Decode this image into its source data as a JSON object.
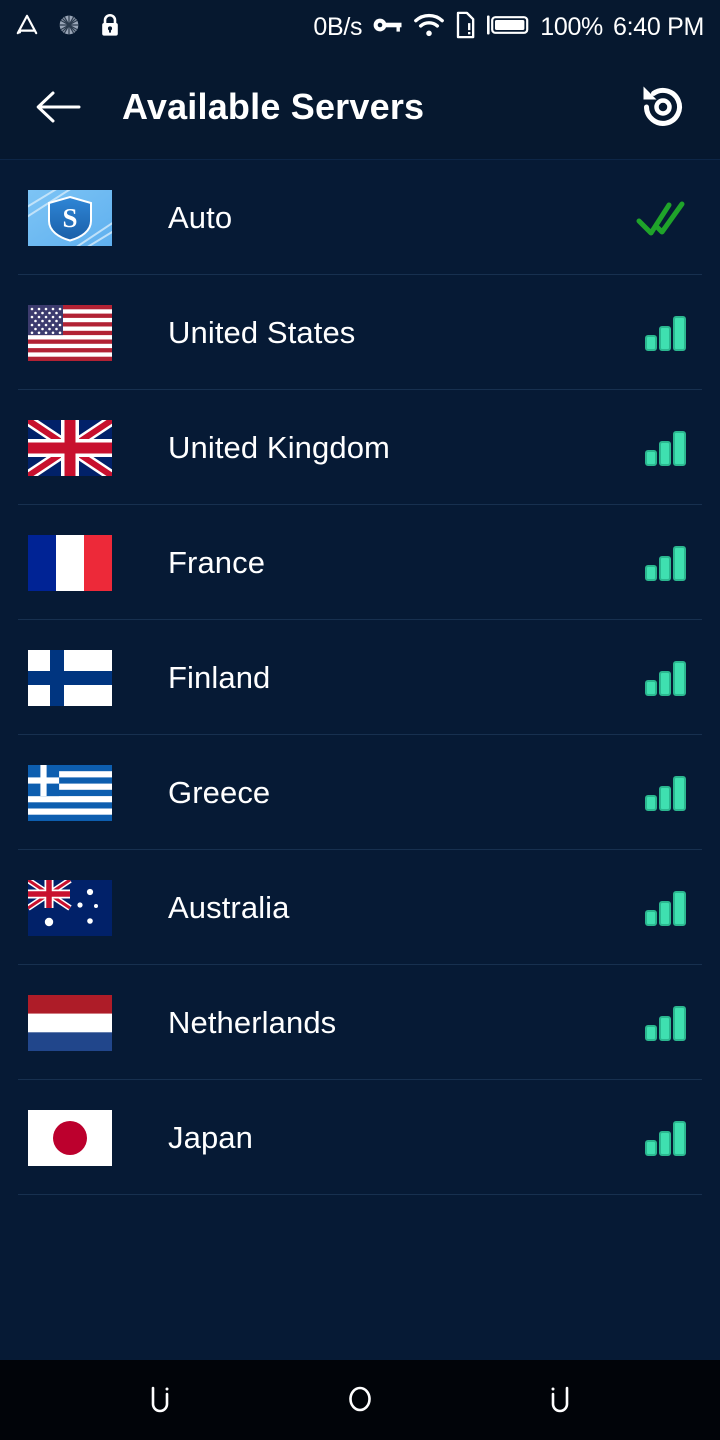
{
  "status_bar": {
    "left_icons": [
      {
        "name": "adb-triangle-icon",
        "glyph": "triangle"
      },
      {
        "name": "sync-circle-icon",
        "glyph": "dotted-circle"
      },
      {
        "name": "screen-lock-icon",
        "glyph": "lock"
      }
    ],
    "network_speed": "0B/s",
    "right_icons": [
      {
        "name": "vpn-key-icon",
        "glyph": "key"
      },
      {
        "name": "wifi-icon",
        "glyph": "wifi"
      },
      {
        "name": "sim-card-alert-icon",
        "glyph": "sim-alert"
      },
      {
        "name": "battery-full-icon",
        "glyph": "battery"
      }
    ],
    "battery_percent": "100%",
    "clock": "6:40 PM"
  },
  "header": {
    "back_label": "back-arrow",
    "title": "Available Servers",
    "refresh_label": "refresh-history"
  },
  "colors": {
    "screen_background": "#061a35",
    "bar_background": "#06182f",
    "divider": "#17304f",
    "signal_accent": "#3fe0b0",
    "check_accent": "#1fa32a",
    "text_primary": "#ffffff",
    "nav_background": "#010409"
  },
  "servers": [
    {
      "name": "Auto",
      "icon": "auto-shield-icon",
      "flag": "auto",
      "status": "selected",
      "status_icon": "double-check-icon",
      "signal_bars": 0
    },
    {
      "name": "United States",
      "icon": "flag-us",
      "flag": "us",
      "status": "available",
      "status_icon": "signal-bars-icon",
      "signal_bars": 3
    },
    {
      "name": "United Kingdom",
      "icon": "flag-gb",
      "flag": "gb",
      "status": "available",
      "status_icon": "signal-bars-icon",
      "signal_bars": 3
    },
    {
      "name": "France",
      "icon": "flag-fr",
      "flag": "fr",
      "status": "available",
      "status_icon": "signal-bars-icon",
      "signal_bars": 3
    },
    {
      "name": "Finland",
      "icon": "flag-fi",
      "flag": "fi",
      "status": "available",
      "status_icon": "signal-bars-icon",
      "signal_bars": 3
    },
    {
      "name": "Greece",
      "icon": "flag-gr",
      "flag": "gr",
      "status": "available",
      "status_icon": "signal-bars-icon",
      "signal_bars": 3
    },
    {
      "name": "Australia",
      "icon": "flag-au",
      "flag": "au",
      "status": "available",
      "status_icon": "signal-bars-icon",
      "signal_bars": 3
    },
    {
      "name": "Netherlands",
      "icon": "flag-nl",
      "flag": "nl",
      "status": "available",
      "status_icon": "signal-bars-icon",
      "signal_bars": 3
    },
    {
      "name": "Japan",
      "icon": "flag-jp",
      "flag": "jp",
      "status": "available",
      "status_icon": "signal-bars-icon",
      "signal_bars": 3
    }
  ],
  "nav_bar": {
    "buttons": [
      {
        "name": "nav-back-button",
        "glyph": "back-c"
      },
      {
        "name": "nav-home-button",
        "glyph": "circle"
      },
      {
        "name": "nav-recents-button",
        "glyph": "recents-c"
      }
    ]
  }
}
